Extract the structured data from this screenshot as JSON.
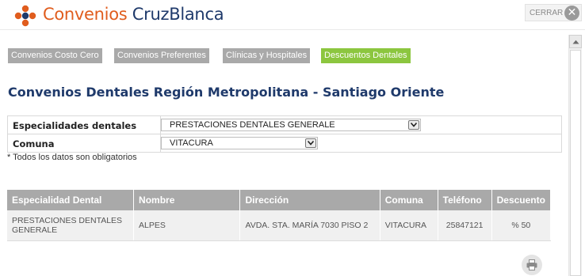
{
  "header": {
    "brand_part1": "Convenios",
    "brand_part2": "CruzBlanca",
    "close_label": "CERRAR",
    "close_glyph": "✕",
    "brand_colors": {
      "orange": "#e05d1e",
      "navy": "#1f3a6b",
      "green": "#8cc63f"
    }
  },
  "tabs": [
    {
      "label": "Convenios Costo Cero",
      "active": false
    },
    {
      "label": "Convenios Preferentes",
      "active": false
    },
    {
      "label": "Clínicas y Hospitales",
      "active": false
    },
    {
      "label": "Descuentos Dentales",
      "active": true
    }
  ],
  "page_title": "Convenios Dentales Región Metropolitana - Santiago Oriente",
  "form": {
    "specialty_label": "Especialidades dentales",
    "specialty_value": "PRESTACIONES DENTALES GENERALE",
    "comuna_label": "Comuna",
    "comuna_value": "VITACURA",
    "required_note": "* Todos los datos son obligatorios"
  },
  "table": {
    "headers": [
      "Especialidad Dental",
      "Nombre",
      "Dirección",
      "Comuna",
      "Teléfono",
      "Descuento"
    ],
    "rows": [
      [
        "PRESTACIONES DENTALES GENERALE",
        "ALPES",
        "AVDA. STA. MARÍA 7030 PISO 2",
        "VITACURA",
        "25847121",
        "% 50"
      ]
    ]
  },
  "icons": {
    "logo": "cruzblanca-logo-icon",
    "close": "close-icon",
    "dropdown": "chevron-down-icon",
    "print": "printer-icon",
    "scroll_up": "arrow-up-icon"
  }
}
